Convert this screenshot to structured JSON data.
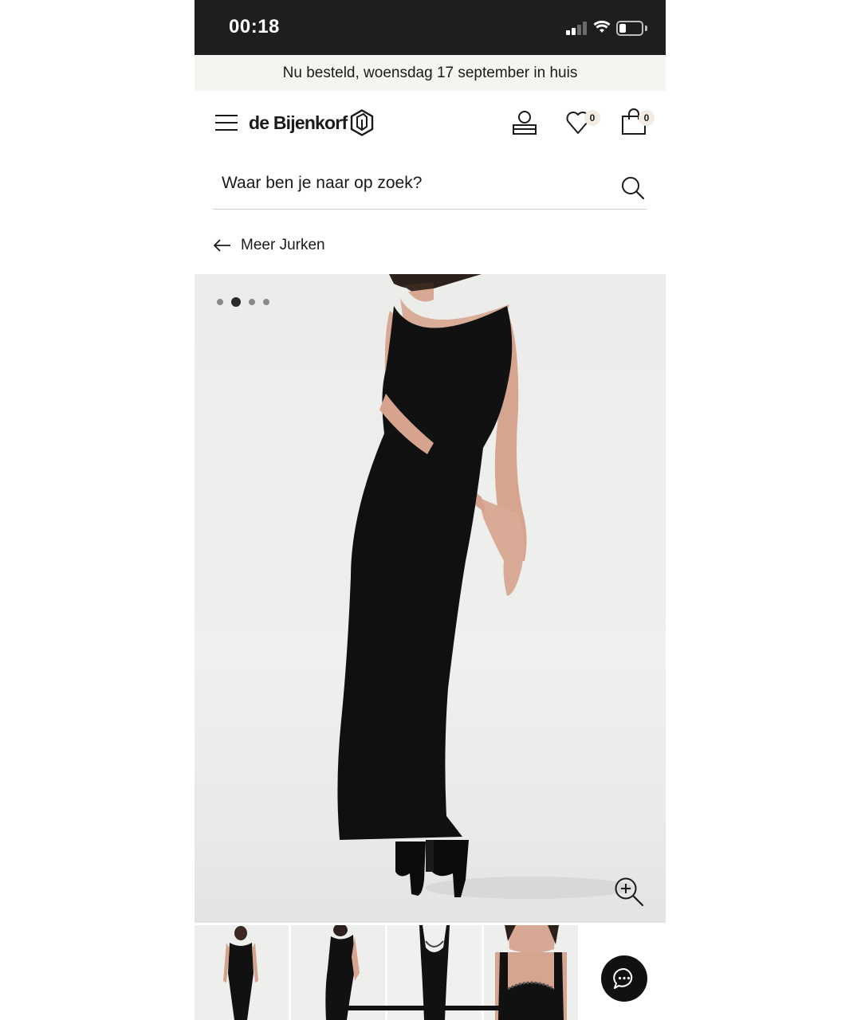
{
  "status_bar": {
    "time": "00:18",
    "icons": [
      "cellular-signal-icon",
      "wifi-icon",
      "battery-icon"
    ]
  },
  "delivery_banner": {
    "text": "Nu besteld, woensdag 17 september in huis"
  },
  "header": {
    "menu_icon": "hamburger-menu-icon",
    "logo_text": "de Bijenkorf",
    "account_icon": "user-account-icon",
    "wishlist_count": "0",
    "bag_count": "0"
  },
  "search": {
    "placeholder": "Waar ben je naar op zoek?",
    "value": ""
  },
  "back_link": {
    "label": "Meer Jurken"
  },
  "gallery": {
    "image_count": 4,
    "active_index": 2,
    "thumbnail_count": 4
  },
  "colors": {
    "status_bar_bg": "#1e1e1e",
    "banner_bg": "#f6f4f1",
    "badge_bg": "#f2ece3",
    "dress": "#111111",
    "image_bg": "#ececea"
  }
}
